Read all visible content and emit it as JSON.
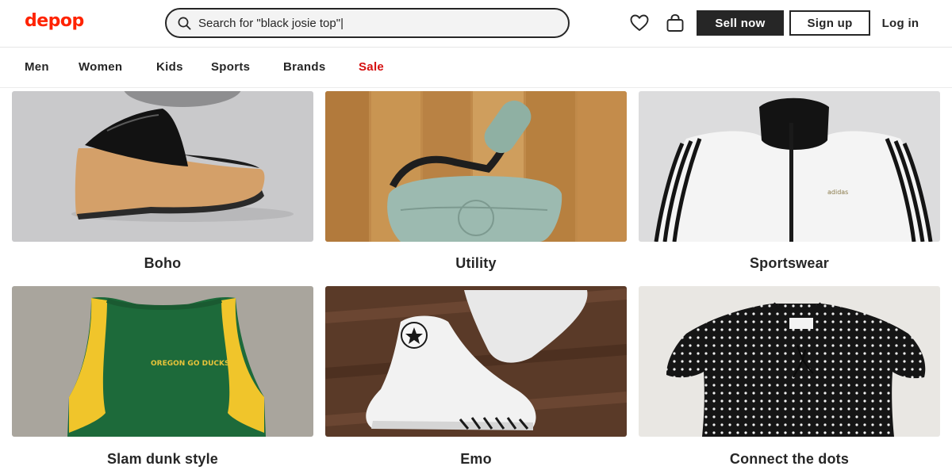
{
  "header": {
    "logo": "depop",
    "search": {
      "value": "",
      "placeholder": "Search for \"black josie top\"|"
    },
    "sell_label": "Sell now",
    "signup_label": "Sign up",
    "login_label": "Log in"
  },
  "nav": {
    "items": [
      {
        "label": "Men"
      },
      {
        "label": "Women"
      },
      {
        "label": "Kids"
      },
      {
        "label": "Sports"
      },
      {
        "label": "Brands"
      },
      {
        "label": "Sale"
      }
    ]
  },
  "categories": [
    {
      "label": "Boho",
      "image": "platform-sandal"
    },
    {
      "label": "Utility",
      "image": "crossbody-bag"
    },
    {
      "label": "Sportswear",
      "image": "track-jacket"
    },
    {
      "label": "Slam dunk style",
      "image": "basketball-jersey"
    },
    {
      "label": "Emo",
      "image": "white-high-top-sneakers"
    },
    {
      "label": "Connect the dots",
      "image": "polka-dot-top"
    }
  ],
  "image_text": {
    "jersey_print": "OREGON GO DUCKS",
    "jacket_brand": "adidas"
  },
  "colors": {
    "brand": "#ff2300",
    "sale": "#d50f0f",
    "text": "#262626",
    "search_bg": "#f3f3f3"
  },
  "icons": [
    "search-icon",
    "heart-icon",
    "bag-icon"
  ]
}
